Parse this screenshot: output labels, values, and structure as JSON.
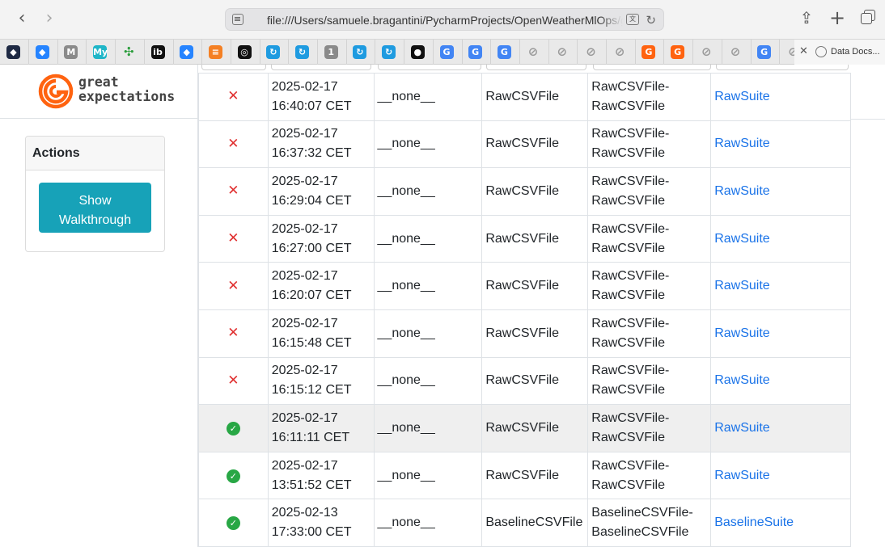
{
  "browser": {
    "url": "file:///Users/samuele.bragantini/PycharmProjects/OpenWeatherMlOps/gx",
    "active_tab_title": "Data Docs...",
    "favicons": [
      {
        "icon": "dark-hex-icon",
        "glyph": "◆",
        "bg": "#1f2a44"
      },
      {
        "icon": "jira-icon",
        "glyph": "◆",
        "bg": "#2684ff"
      },
      {
        "icon": "medium-m-icon",
        "glyph": "M",
        "bg": "#8a8a8a"
      },
      {
        "icon": "my-app-icon",
        "glyph": "My",
        "bg": "#1fb6c8"
      },
      {
        "icon": "airflow-icon",
        "glyph": "✣",
        "bg": "#e9e9e9"
      },
      {
        "icon": "ib-icon",
        "glyph": "ib",
        "bg": "#111111"
      },
      {
        "icon": "jira-icon",
        "glyph": "◆",
        "bg": "#2684ff"
      },
      {
        "icon": "stackoverflow-icon",
        "glyph": "≡",
        "bg": "#f48024"
      },
      {
        "icon": "openai-icon",
        "glyph": "◎",
        "bg": "#111111"
      },
      {
        "icon": "sync-icon",
        "glyph": "↻",
        "bg": "#1f9be0"
      },
      {
        "icon": "sync-icon",
        "glyph": "↻",
        "bg": "#1f9be0"
      },
      {
        "icon": "onepassword-icon",
        "glyph": "1",
        "bg": "#8a8a8a"
      },
      {
        "icon": "sync-icon",
        "glyph": "↻",
        "bg": "#1f9be0"
      },
      {
        "icon": "sync-icon",
        "glyph": "↻",
        "bg": "#1f9be0"
      },
      {
        "icon": "github-icon",
        "glyph": "●",
        "bg": "#111111"
      },
      {
        "icon": "google-icon",
        "glyph": "G",
        "bg": "#4285f4"
      },
      {
        "icon": "google-icon",
        "glyph": "G",
        "bg": "#4285f4"
      },
      {
        "icon": "google-icon",
        "glyph": "G",
        "bg": "#4285f4"
      },
      {
        "icon": "compass-icon",
        "glyph": "⊘",
        "bg": "#9a9a9a"
      },
      {
        "icon": "compass-icon",
        "glyph": "⊘",
        "bg": "#9a9a9a"
      },
      {
        "icon": "compass-icon",
        "glyph": "⊘",
        "bg": "#9a9a9a"
      },
      {
        "icon": "compass-icon",
        "glyph": "⊘",
        "bg": "#9a9a9a"
      },
      {
        "icon": "great-expectations-icon",
        "glyph": "G",
        "bg": "#ff6310"
      },
      {
        "icon": "great-expectations-icon",
        "glyph": "G",
        "bg": "#ff6310"
      },
      {
        "icon": "compass-icon",
        "glyph": "⊘",
        "bg": "#9a9a9a"
      },
      {
        "icon": "compass-icon",
        "glyph": "⊘",
        "bg": "#9a9a9a"
      },
      {
        "icon": "google-icon",
        "glyph": "G",
        "bg": "#4285f4"
      },
      {
        "icon": "compass-icon",
        "glyph": "⊘",
        "bg": "#9a9a9a"
      }
    ]
  },
  "logo": {
    "line1": "great",
    "line2": "expectations",
    "color": "#ff6310"
  },
  "actions": {
    "title": "Actions",
    "walkthrough_line1": "Show",
    "walkthrough_line2": "Walkthrough",
    "button_color": "#17a2b8"
  },
  "colors": {
    "fail": "#e03030",
    "success": "#28a745",
    "link": "#1a73e8"
  },
  "runs": [
    {
      "status": "fail",
      "date": "2025-02-17",
      "time": "16:40:07 CET",
      "run_name": "__none__",
      "asset": "RawCSVFile",
      "batch_line1": "RawCSVFile-",
      "batch_line2": "RawCSVFile",
      "suite": "RawSuite"
    },
    {
      "status": "fail",
      "date": "2025-02-17",
      "time": "16:37:32 CET",
      "run_name": "__none__",
      "asset": "RawCSVFile",
      "batch_line1": "RawCSVFile-",
      "batch_line2": "RawCSVFile",
      "suite": "RawSuite"
    },
    {
      "status": "fail",
      "date": "2025-02-17",
      "time": "16:29:04 CET",
      "run_name": "__none__",
      "asset": "RawCSVFile",
      "batch_line1": "RawCSVFile-",
      "batch_line2": "RawCSVFile",
      "suite": "RawSuite"
    },
    {
      "status": "fail",
      "date": "2025-02-17",
      "time": "16:27:00 CET",
      "run_name": "__none__",
      "asset": "RawCSVFile",
      "batch_line1": "RawCSVFile-",
      "batch_line2": "RawCSVFile",
      "suite": "RawSuite"
    },
    {
      "status": "fail",
      "date": "2025-02-17",
      "time": "16:20:07 CET",
      "run_name": "__none__",
      "asset": "RawCSVFile",
      "batch_line1": "RawCSVFile-",
      "batch_line2": "RawCSVFile",
      "suite": "RawSuite"
    },
    {
      "status": "fail",
      "date": "2025-02-17",
      "time": "16:15:48 CET",
      "run_name": "__none__",
      "asset": "RawCSVFile",
      "batch_line1": "RawCSVFile-",
      "batch_line2": "RawCSVFile",
      "suite": "RawSuite"
    },
    {
      "status": "fail",
      "date": "2025-02-17",
      "time": "16:15:12 CET",
      "run_name": "__none__",
      "asset": "RawCSVFile",
      "batch_line1": "RawCSVFile-",
      "batch_line2": "RawCSVFile",
      "suite": "RawSuite"
    },
    {
      "status": "success",
      "date": "2025-02-17",
      "time": "16:11:11 CET",
      "run_name": "__none__",
      "asset": "RawCSVFile",
      "batch_line1": "RawCSVFile-",
      "batch_line2": "RawCSVFile",
      "suite": "RawSuite",
      "highlighted": true
    },
    {
      "status": "success",
      "date": "2025-02-17",
      "time": "13:51:52 CET",
      "run_name": "__none__",
      "asset": "RawCSVFile",
      "batch_line1": "RawCSVFile-",
      "batch_line2": "RawCSVFile",
      "suite": "RawSuite"
    },
    {
      "status": "success",
      "date": "2025-02-13",
      "time": "17:33:00 CET",
      "run_name": "__none__",
      "asset": "BaselineCSVFile",
      "batch_line1": "BaselineCSVFile-",
      "batch_line2": "BaselineCSVFile",
      "suite": "BaselineSuite"
    }
  ]
}
